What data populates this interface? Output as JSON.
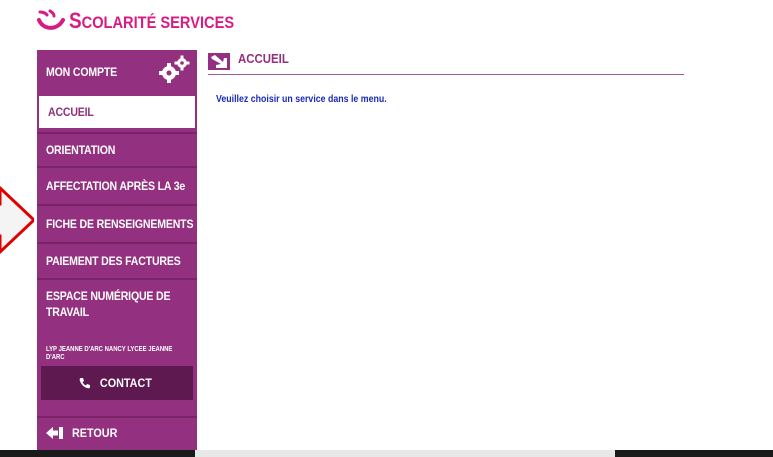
{
  "brand": {
    "name": "Scolarité services",
    "color": "#d81b82",
    "accent": "#93307f"
  },
  "sidebar": {
    "items": [
      {
        "label": "MON COMPTE",
        "icon": "gears-icon"
      },
      {
        "label": "ACCUEIL",
        "active": true
      },
      {
        "label": "ORIENTATION"
      },
      {
        "label": "AFFECTATION APRÈS LA 3e"
      },
      {
        "label": "FICHE DE RENSEIGNEMENTS"
      },
      {
        "label": "PAIEMENT DES FACTURES"
      },
      {
        "label": "ESPACE NUMÉRIQUE DE TRAVAIL"
      }
    ],
    "school": "LYP JEANNE D'ARC NANCY LYCEE JEANNE D'ARC",
    "contact_label": "CONTACT",
    "contact_icon": "phone-icon",
    "retour_label": "RETOUR",
    "retour_icon": "back-arrow-icon"
  },
  "main": {
    "title": "ACCUEIL",
    "title_icon": "arrow-down-right-icon",
    "message": "Veuillez choisir un service dans le menu."
  },
  "annotation": {
    "icon": "red-arrow-left-icon",
    "color": "#e00000"
  }
}
